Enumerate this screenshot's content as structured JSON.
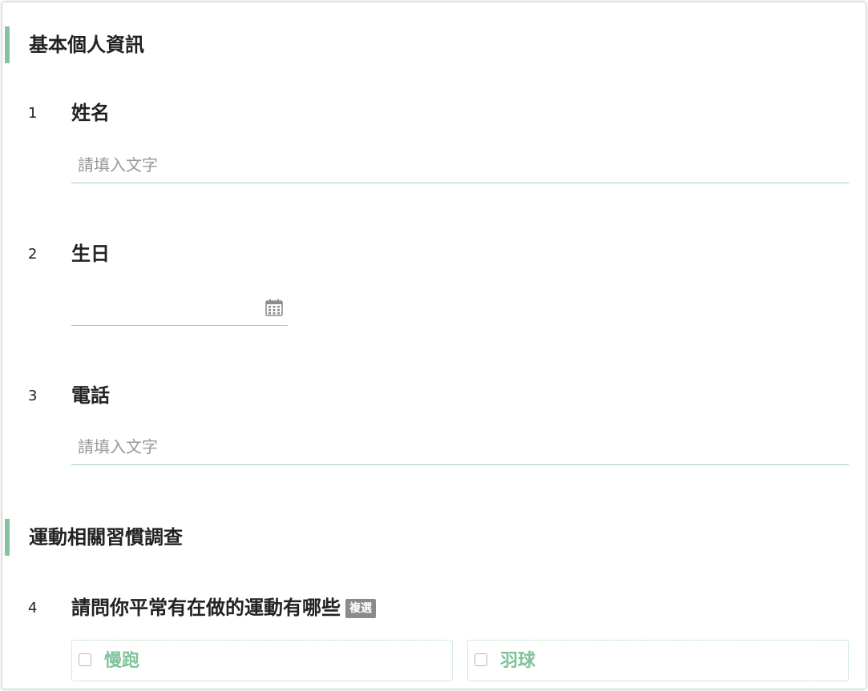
{
  "sections": [
    {
      "title": "基本個人資訊"
    },
    {
      "title": "運動相關習慣調查"
    }
  ],
  "questions": [
    {
      "number": "1",
      "label": "姓名",
      "placeholder": "請填入文字"
    },
    {
      "number": "2",
      "label": "生日"
    },
    {
      "number": "3",
      "label": "電話",
      "placeholder": "請填入文字"
    },
    {
      "number": "4",
      "label": "請問你平常有在做的運動有哪些",
      "badge": "複選",
      "options": [
        {
          "label": "慢跑"
        },
        {
          "label": "羽球"
        }
      ]
    }
  ],
  "icons": {
    "date_picker": "calendar-icon"
  },
  "colors": {
    "accent": "#86c3a0",
    "input_underline": "#9fd3b6",
    "option_text": "#7fc39a",
    "badge_bg": "#8a8a8a",
    "placeholder": "#999999"
  }
}
